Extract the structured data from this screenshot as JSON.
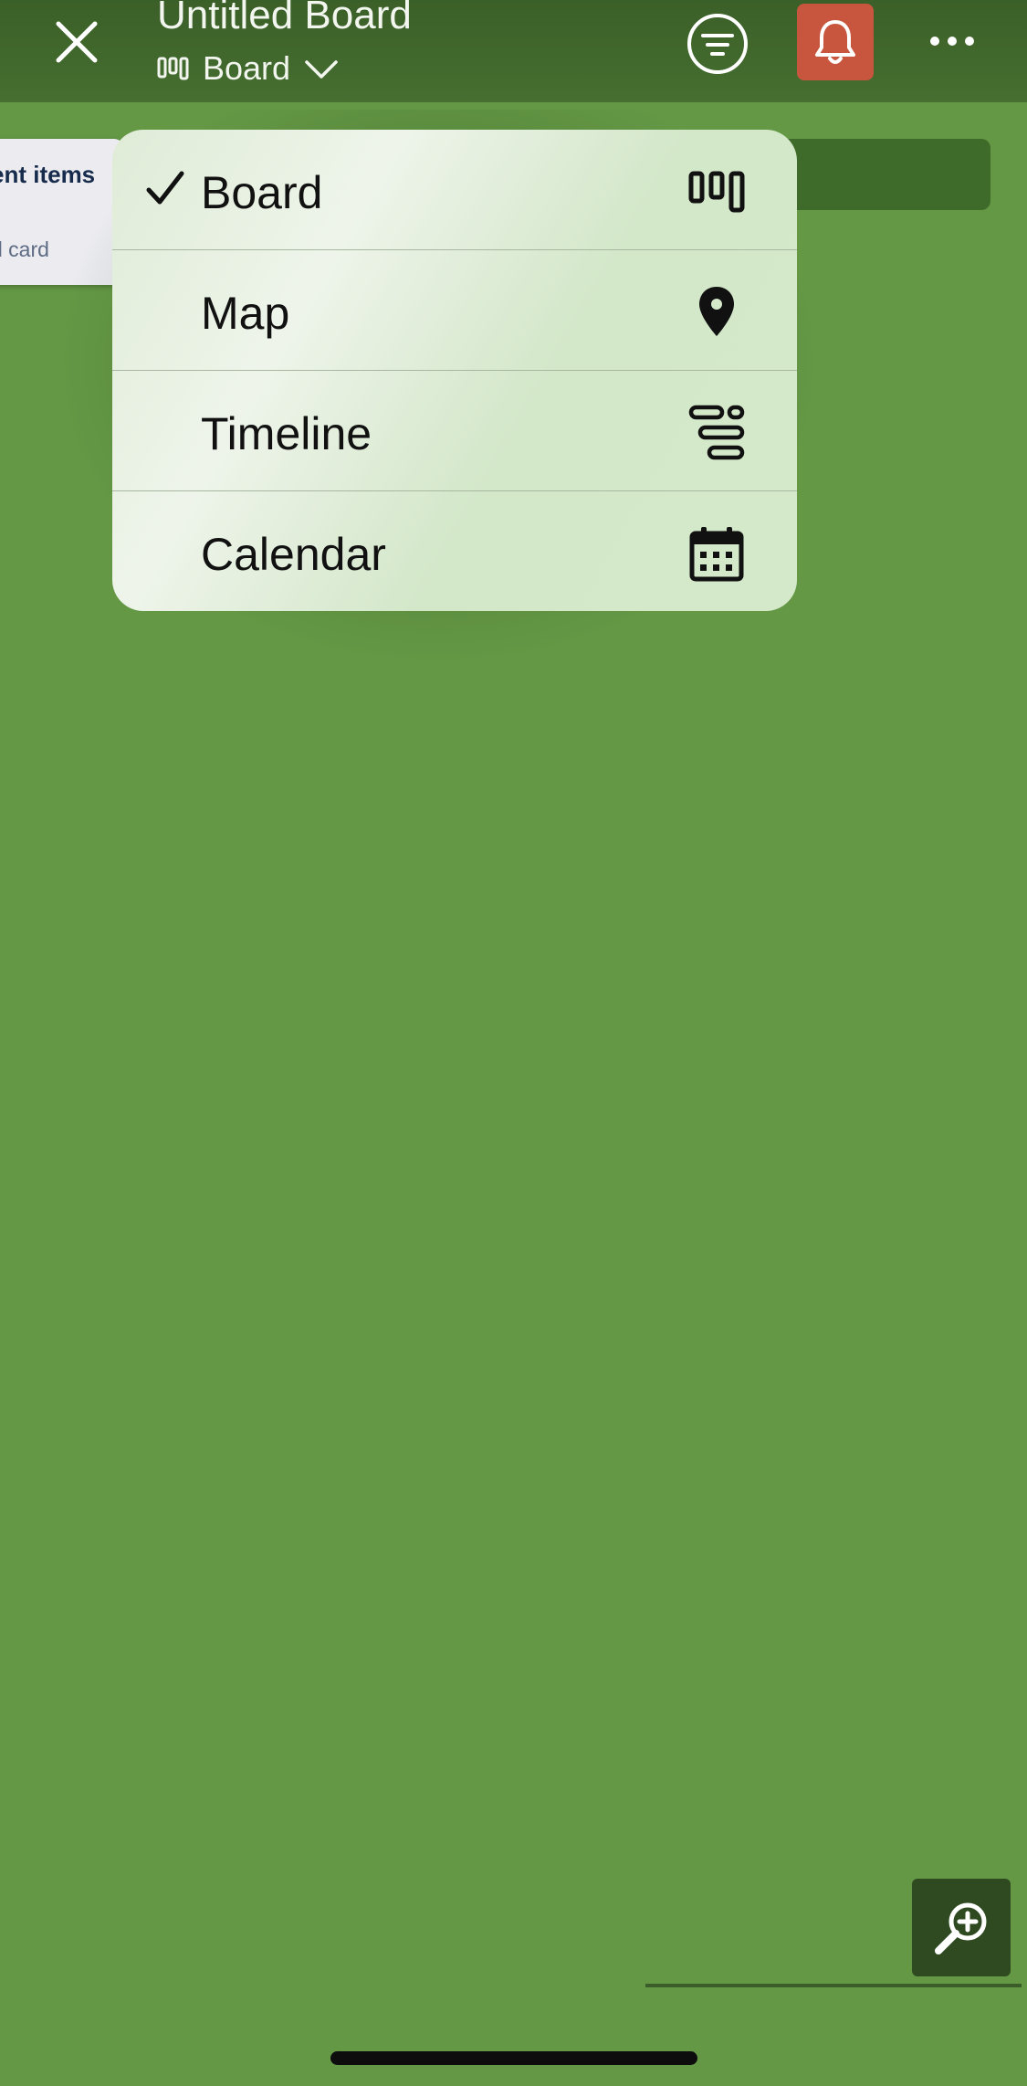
{
  "header": {
    "title": "Untitled Board",
    "current_view": "Board",
    "close_icon": "close-icon",
    "filter_icon": "filter-icon",
    "notification_icon": "bell-icon",
    "notification_color": "#c8563f",
    "more_icon": "ellipsis-icon"
  },
  "board": {
    "list_title": "ent items",
    "add_card": "d card"
  },
  "view_menu": {
    "items": [
      {
        "label": "Board",
        "selected": true,
        "icon": "board-icon"
      },
      {
        "label": "Map",
        "selected": false,
        "icon": "map-pin-icon"
      },
      {
        "label": "Timeline",
        "selected": false,
        "icon": "timeline-icon"
      },
      {
        "label": "Calendar",
        "selected": false,
        "icon": "calendar-icon"
      }
    ]
  },
  "colors": {
    "background": "#649845",
    "header": "#3b5f28",
    "menu": "#d4e8ca"
  },
  "zoom_icon": "zoom-in-icon"
}
